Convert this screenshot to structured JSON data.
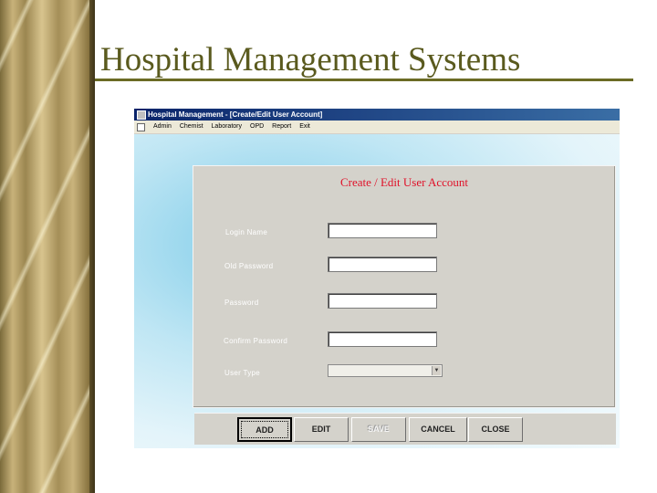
{
  "slide": {
    "title": "Hospital Management Systems"
  },
  "window": {
    "title": "Hospital Management - [Create/Edit User Account]",
    "menu": [
      "Admin",
      "Chemist",
      "Laboratory",
      "OPD",
      "Report",
      "Exit"
    ]
  },
  "form": {
    "title": "Create / Edit User Account",
    "fields": [
      {
        "label": "Login Name",
        "value": ""
      },
      {
        "label": "Old Password",
        "value": ""
      },
      {
        "label": "Password",
        "value": ""
      },
      {
        "label": "Confirm Password",
        "value": ""
      }
    ],
    "user_type": {
      "label": "User Type",
      "value": ""
    }
  },
  "buttons": {
    "add": "ADD",
    "edit": "EDIT",
    "save": "SAVE",
    "cancel": "CANCEL",
    "close": "CLOSE"
  },
  "colors": {
    "slide_title": "#5a5a1e",
    "form_title": "#e0122a",
    "titlebar": "#0a246a",
    "form_bg": "#d4d2cb"
  }
}
